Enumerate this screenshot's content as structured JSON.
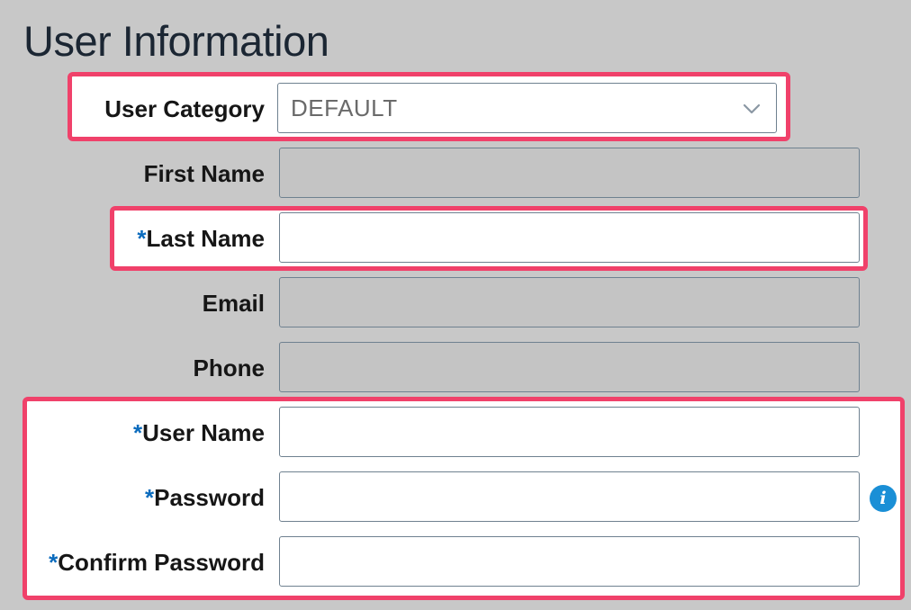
{
  "page": {
    "title": "User Information"
  },
  "form": {
    "user_category": {
      "label": "User Category",
      "value": "DEFAULT",
      "icon": "chevron-down-icon"
    },
    "first_name": {
      "label": "First Name",
      "value": ""
    },
    "last_name": {
      "label": "Last Name",
      "required_mark": "*",
      "value": ""
    },
    "email": {
      "label": "Email",
      "value": ""
    },
    "phone": {
      "label": "Phone",
      "value": ""
    },
    "user_name": {
      "label": "User Name",
      "required_mark": "*",
      "value": ""
    },
    "password": {
      "label": "Password",
      "required_mark": "*",
      "value": "",
      "info_icon": "i"
    },
    "confirm_password": {
      "label": "Confirm Password",
      "required_mark": "*",
      "value": ""
    }
  },
  "colors": {
    "background": "#c8c8c8",
    "highlight_border": "#f0416a",
    "required_asterisk": "#0a6bbd",
    "info_icon": "#1a8fd6",
    "title_text": "#1b2633"
  }
}
